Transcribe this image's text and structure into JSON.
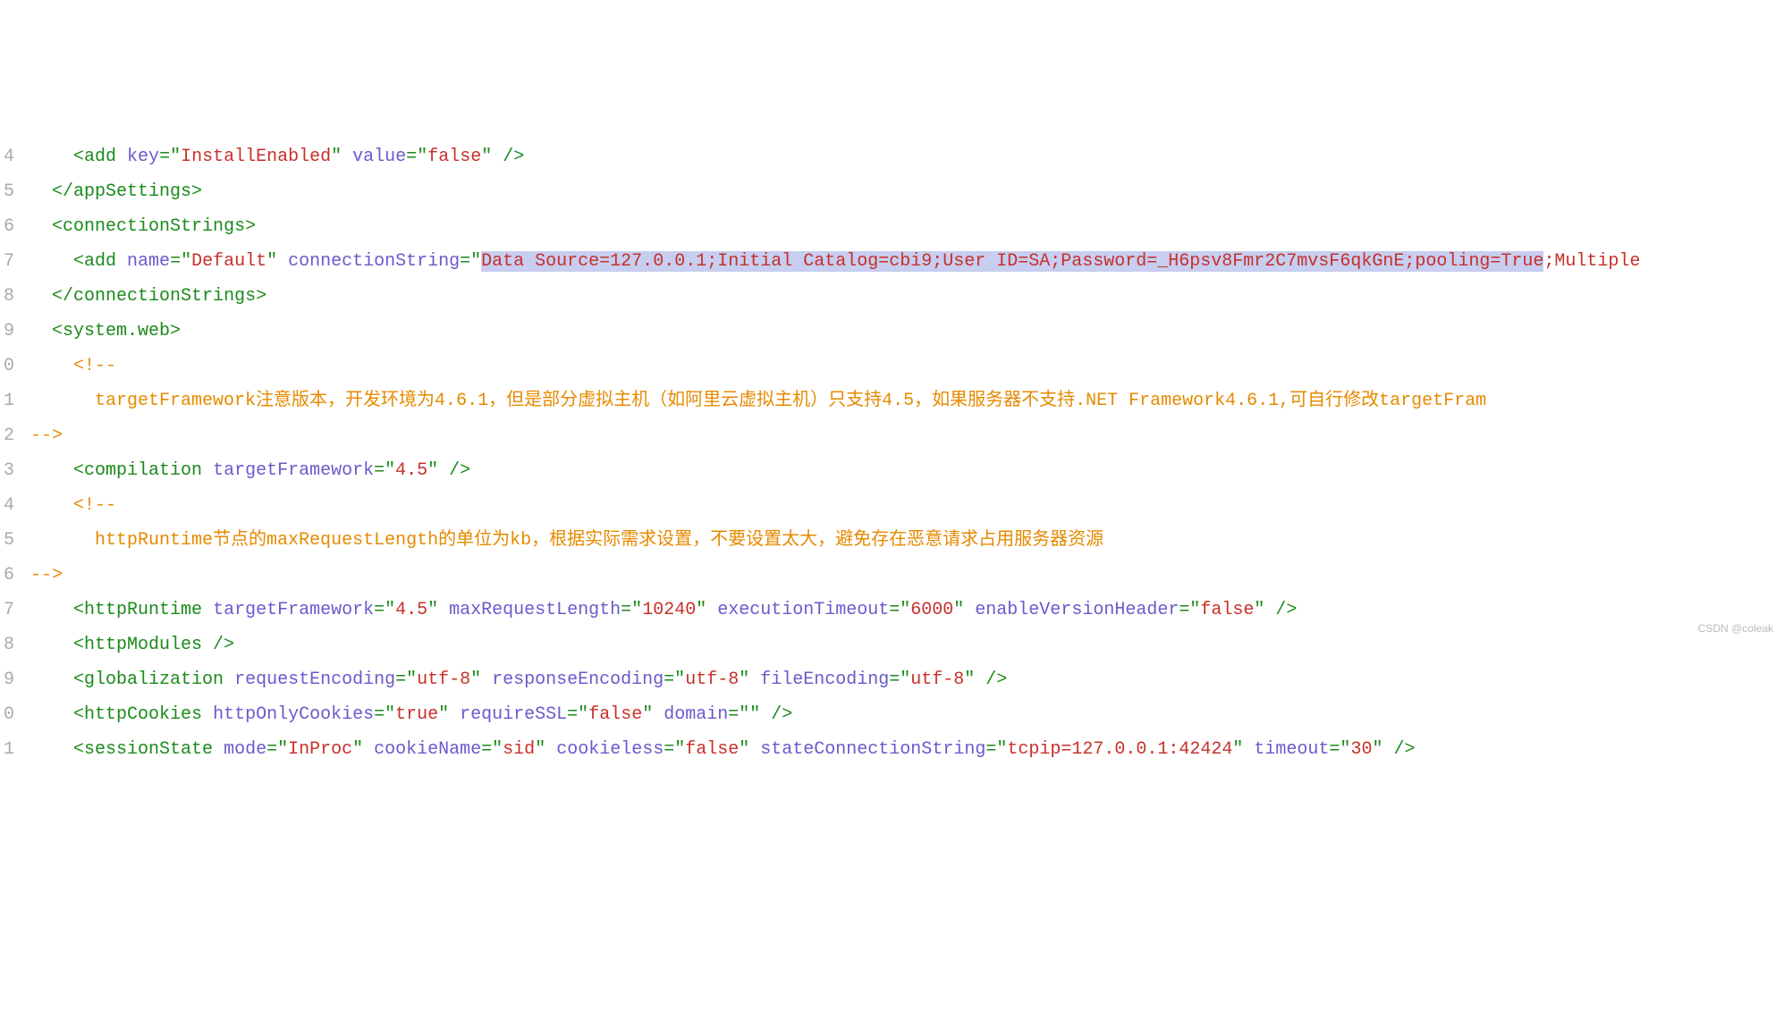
{
  "gutter": [
    "4",
    "5",
    "6",
    "7",
    "8",
    "9",
    "0",
    "1",
    "2",
    "3",
    "4",
    "5",
    "6",
    "7",
    "8",
    "9",
    "0",
    "1"
  ],
  "lines": {
    "l4": {
      "indent": "    ",
      "tag_open": "<add ",
      "a1": "key",
      "eq": "=",
      "q": "\"",
      "v1": "InstallEnabled",
      "sp": " ",
      "a2": "value",
      "v2": "false",
      "tag_close": " />"
    },
    "l5": {
      "indent": "  ",
      "text": "</appSettings>"
    },
    "l6": {
      "indent": "  ",
      "text": "<connectionStrings>"
    },
    "l7": {
      "indent": "    ",
      "tag_open": "<add ",
      "a1": "name",
      "v1": "Default",
      "a2": "connectionString",
      "hl": "Data Source=127.0.0.1;Initial Catalog=cbi9;User ID=SA;Password=_H6psv8Fmr2C7mvsF6qkGnE;pooling=True",
      "tail": ";Multiple"
    },
    "l8": {
      "indent": "  ",
      "text": "</connectionStrings>"
    },
    "l9": {
      "indent": "  ",
      "text": "<system.web>"
    },
    "l10": {
      "indent": "    ",
      "text": "<!--"
    },
    "l11": {
      "indent": "      ",
      "text": "targetFramework注意版本，开发环境为4.6.1，但是部分虚拟主机（如阿里云虚拟主机）只支持4.5，如果服务器不支持.NET Framework4.6.1,可自行修改targetFram"
    },
    "l12": {
      "text": "-->"
    },
    "l13": {
      "indent": "    ",
      "tag_open": "<compilation ",
      "a1": "targetFramework",
      "v1": "4.5",
      "tag_close": " />"
    },
    "l14": {
      "indent": "    ",
      "text": "<!--"
    },
    "l15": {
      "indent": "      ",
      "text": "httpRuntime节点的maxRequestLength的单位为kb，根据实际需求设置，不要设置太大，避免存在恶意请求占用服务器资源"
    },
    "l16": {
      "text": "-->"
    },
    "l17": {
      "indent": "    ",
      "tag_open": "<httpRuntime ",
      "a1": "targetFramework",
      "v1": "4.5",
      "a2": "maxRequestLength",
      "v2": "10240",
      "a3": "executionTimeout",
      "v3": "6000",
      "a4": "enableVersionHeader",
      "v4": "false",
      "tag_close": " />"
    },
    "l18": {
      "indent": "    ",
      "text": "<httpModules />"
    },
    "l19": {
      "indent": "    ",
      "tag_open": "<globalization ",
      "a1": "requestEncoding",
      "v1": "utf-8",
      "a2": "responseEncoding",
      "v2": "utf-8",
      "a3": "fileEncoding",
      "v3": "utf-8",
      "tag_close": " />"
    },
    "l20": {
      "indent": "    ",
      "tag_open": "<httpCookies ",
      "a1": "httpOnlyCookies",
      "v1": "true",
      "a2": "requireSSL",
      "v2": "false",
      "a3": "domain",
      "v3": "",
      "tag_close": " />"
    },
    "l21": {
      "indent": "    ",
      "tag_open": "<sessionState ",
      "a1": "mode",
      "v1": "InProc",
      "a2": "cookieName",
      "v2": "sid",
      "a3": "cookieless",
      "v3": "false",
      "a4": "stateConnectionString",
      "v4": "tcpip=127.0.0.1:42424",
      "a5": "timeout",
      "v5": "30",
      "tag_close": " />"
    }
  },
  "watermark": "CSDN @coleak"
}
